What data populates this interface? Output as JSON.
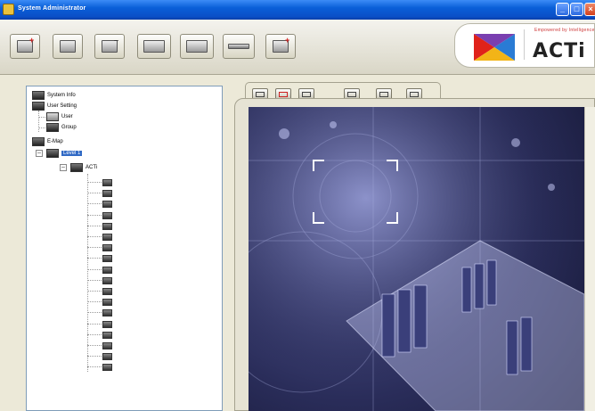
{
  "window": {
    "title": "System Administrator"
  },
  "toolbar": {
    "buttons": [
      {
        "name": "add-camera-button",
        "icon": "add-camera-icon"
      },
      {
        "name": "edit-camera-button",
        "icon": "edit-camera-icon"
      },
      {
        "name": "remove-camera-button",
        "icon": "remove-camera-icon"
      },
      {
        "name": "camera-list-button",
        "icon": "camera-list-icon"
      },
      {
        "name": "camera-group-button",
        "icon": "camera-group-icon"
      },
      {
        "name": "connect-button",
        "icon": "connect-icon"
      },
      {
        "name": "add-map-button",
        "icon": "add-map-icon"
      }
    ]
  },
  "brand": {
    "sub": "Empowered by Intelligence",
    "name": "ACTi"
  },
  "tree": {
    "root_items": [
      {
        "label": "System Info"
      },
      {
        "label": "User Setting"
      },
      {
        "label": "User"
      },
      {
        "label": "Group"
      },
      {
        "label": "E-Map"
      },
      {
        "label": "Level 1"
      },
      {
        "label": "ACTi"
      }
    ],
    "camera_count": 18
  },
  "map_tabs": [
    {
      "icon": "map-view-icon"
    },
    {
      "icon": "map-add-icon"
    },
    {
      "icon": "map-edit-icon"
    },
    {
      "icon": "map-zoom-in-icon"
    },
    {
      "icon": "map-zoom-out-icon"
    },
    {
      "icon": "map-fit-icon"
    }
  ],
  "colors": {
    "accent": "#316ac5",
    "map_tint": "#3a3e78"
  }
}
